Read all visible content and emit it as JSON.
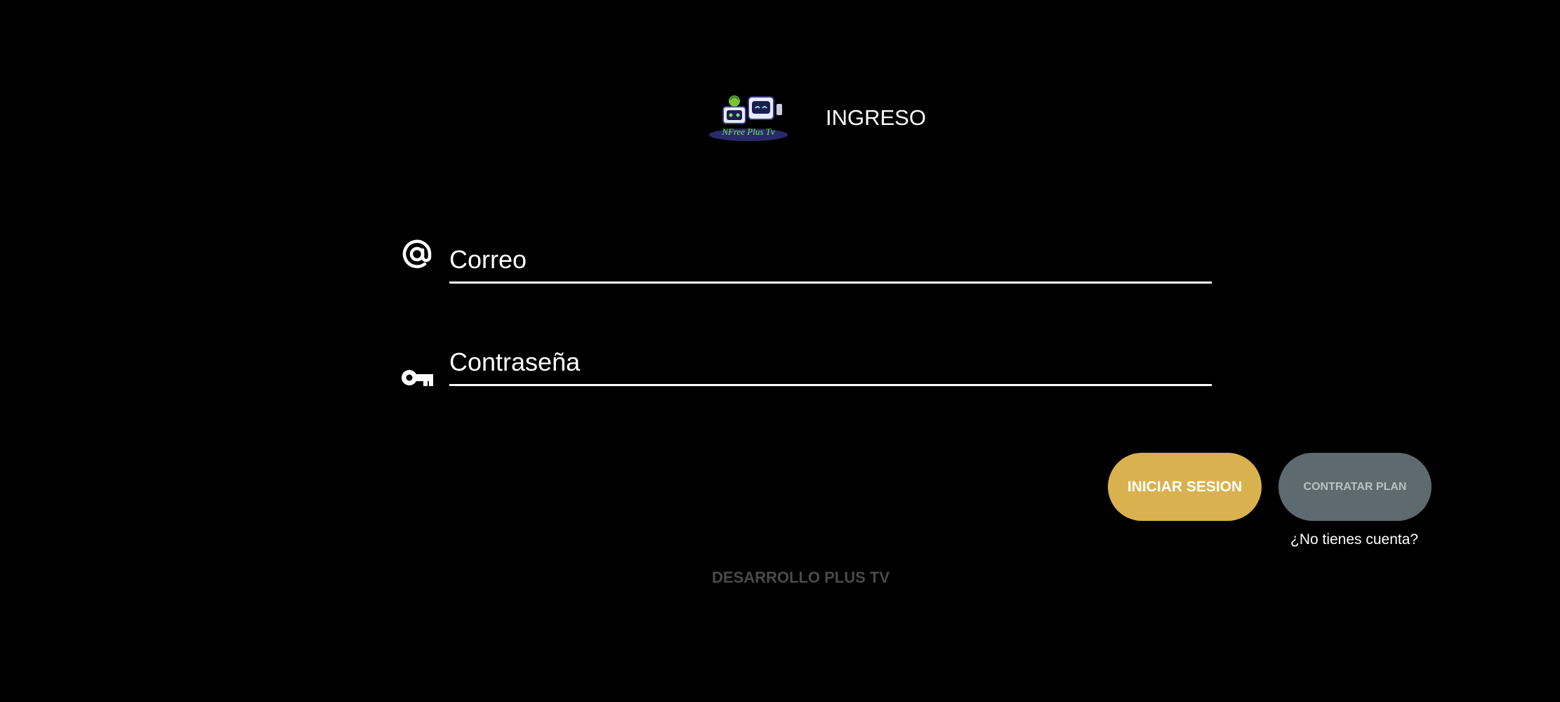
{
  "header": {
    "logo_text": "NFree Plus Tv",
    "title": "INGRESO"
  },
  "form": {
    "email": {
      "icon": "at-sign-icon",
      "placeholder": "Correo",
      "value": ""
    },
    "password": {
      "icon": "key-icon",
      "placeholder": "Contraseña",
      "value": ""
    }
  },
  "actions": {
    "login_label": "INICIAR SESION",
    "plan_label": "CONTRATAR PLAN",
    "no_account_text": "¿No tienes cuenta?"
  },
  "footer": {
    "credit": "DESARROLLO PLUS TV"
  },
  "colors": {
    "background": "#000000",
    "login_button": "#d9b24f",
    "plan_button": "#5d6a70",
    "footer_text": "#4a4a4a"
  }
}
